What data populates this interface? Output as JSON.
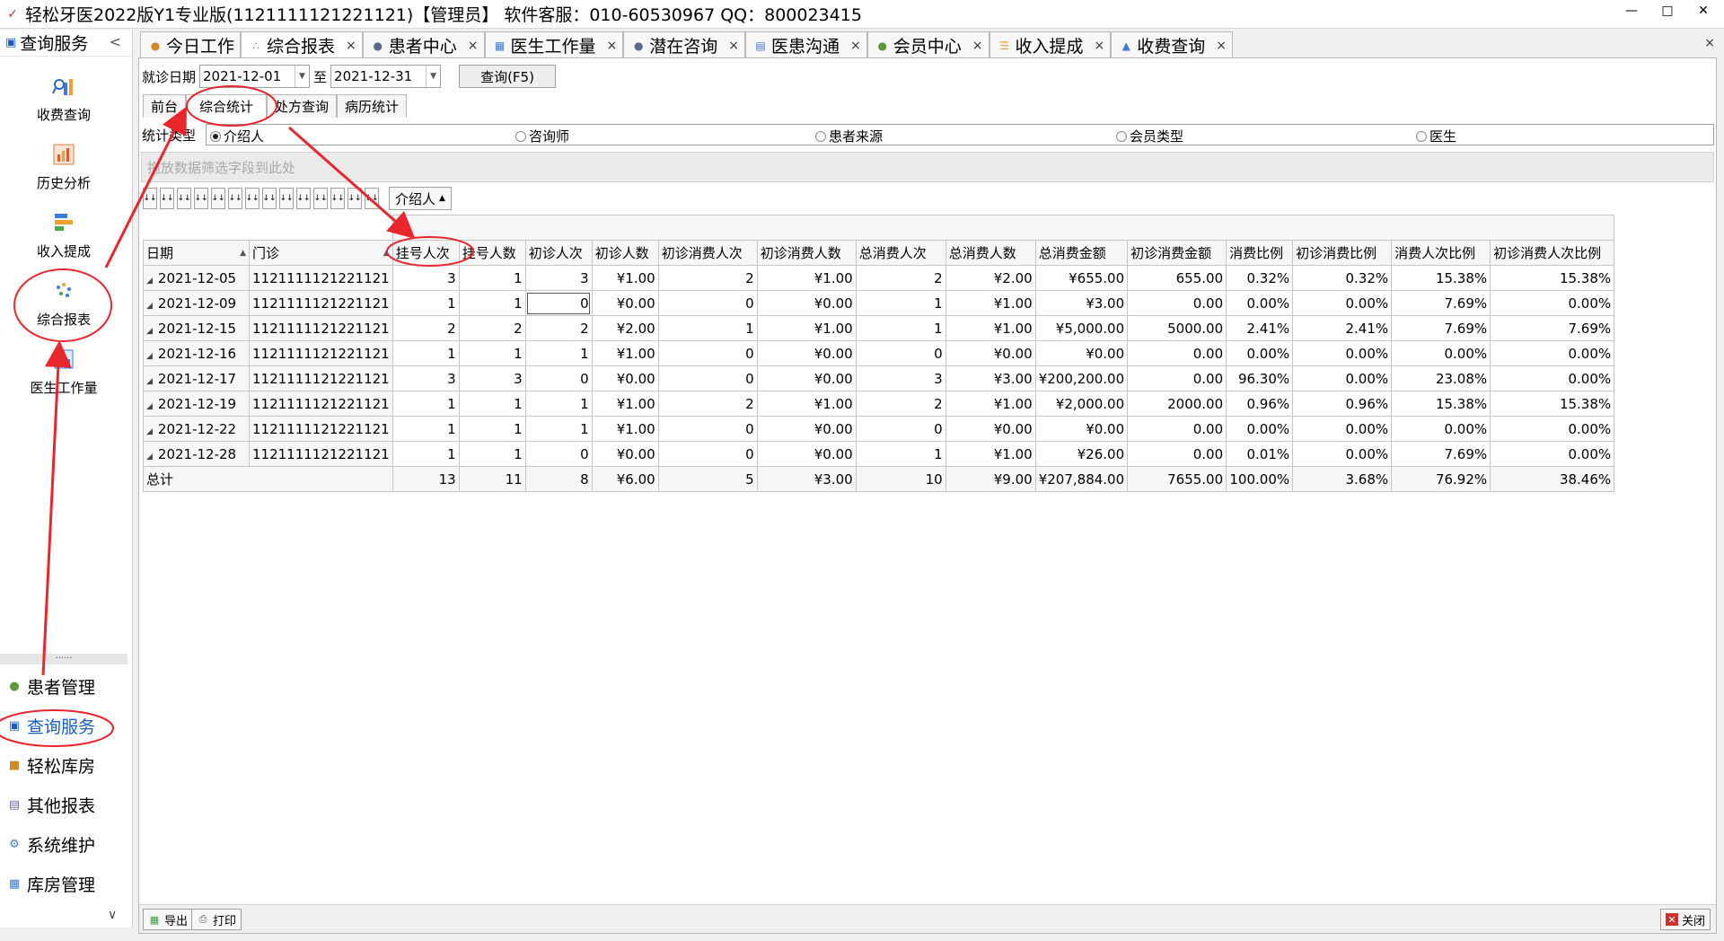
{
  "window": {
    "title": "轻松牙医2022版Y1专业版(1121111121221121)【管理员】    软件客服：010-60530967 QQ：800023415",
    "controls": [
      "—",
      "□",
      "✕"
    ]
  },
  "sidebar": {
    "header": "查询服务",
    "collapse": "<",
    "icon_items": [
      {
        "label": "收费查询",
        "icon": "search-chart-icon"
      },
      {
        "label": "历史分析",
        "icon": "history-chart-icon"
      },
      {
        "label": "收入提成",
        "icon": "income-bars-icon"
      },
      {
        "label": "综合报表",
        "icon": "dots-report-icon"
      },
      {
        "label": "医生工作量",
        "icon": "doctor-workload-icon"
      }
    ],
    "divider": "......",
    "nav_items": [
      {
        "label": "患者管理",
        "icon": "users-icon"
      },
      {
        "label": "查询服务",
        "icon": "query-icon"
      },
      {
        "label": "轻松库房",
        "icon": "box-icon"
      },
      {
        "label": "其他报表",
        "icon": "report-icon"
      },
      {
        "label": "系统维护",
        "icon": "gear-icon"
      },
      {
        "label": "库房管理",
        "icon": "warehouse-icon"
      }
    ],
    "bottom_chevron": "∨"
  },
  "tabs": [
    {
      "label": "今日工作",
      "icon": "person-icon",
      "active": false,
      "closable": false
    },
    {
      "label": "综合报表",
      "icon": "dots-icon",
      "active": true,
      "closable": true
    },
    {
      "label": "患者中心",
      "icon": "patient-icon",
      "active": false,
      "closable": true
    },
    {
      "label": "医生工作量",
      "icon": "doctor-icon",
      "active": false,
      "closable": true
    },
    {
      "label": "潜在咨询",
      "icon": "consult-icon",
      "active": false,
      "closable": true
    },
    {
      "label": "医患沟通",
      "icon": "communication-icon",
      "active": false,
      "closable": true
    },
    {
      "label": "会员中心",
      "icon": "member-icon",
      "active": false,
      "closable": true
    },
    {
      "label": "收入提成",
      "icon": "income-icon",
      "active": false,
      "closable": true
    },
    {
      "label": "收费查询",
      "icon": "charge-icon",
      "active": false,
      "closable": true
    }
  ],
  "close_glyph": "×",
  "filters": {
    "date_label": "就诊日期",
    "date_from": "2021-12-01",
    "to_label": "至",
    "date_to": "2021-12-31",
    "query_button": "查询(F5)"
  },
  "subtabs": [
    {
      "label": "前台",
      "active": false
    },
    {
      "label": "综合统计",
      "active": true
    },
    {
      "label": "处方查询",
      "active": false
    },
    {
      "label": "病历统计",
      "active": false
    }
  ],
  "stat_type": {
    "label": "统计类型",
    "options": [
      {
        "label": "介绍人",
        "selected": true
      },
      {
        "label": "咨询师",
        "selected": false
      },
      {
        "label": "患者来源",
        "selected": false
      },
      {
        "label": "会员类型",
        "selected": false
      },
      {
        "label": "医生",
        "selected": false
      }
    ]
  },
  "filter_area_hint": "拖放数据筛选字段到此处",
  "field_chips": [
    "↓↓",
    "↓↓",
    "↓↓",
    "↓↓",
    "↓↓",
    "↓↓",
    "↓↓",
    "↓↓",
    "↓↓",
    "↓↓",
    "↓↓",
    "↓↓",
    "↓↓",
    "↓↓"
  ],
  "column_field": {
    "label": "介绍人",
    "sort": "▲"
  },
  "grid": {
    "row_headers": [
      {
        "label": "日期",
        "sort": "▲"
      },
      {
        "label": "门诊",
        "sort": "▲"
      }
    ],
    "columns": [
      "挂号人次",
      "挂号人数",
      "初诊人次",
      "初诊人数",
      "初诊消费人次",
      "初诊消费人数",
      "总消费人次",
      "总消费人数",
      "总消费金额",
      "初诊消费金额",
      "消费比例",
      "初诊消费比例",
      "消费人次比例",
      "初诊消费人次比例"
    ],
    "expander": "◢",
    "rows": [
      {
        "date": "2021-12-05",
        "clinic": "1121111121221121",
        "cells": [
          "3",
          "1",
          "3",
          "¥1.00",
          "2",
          "¥1.00",
          "2",
          "¥2.00",
          "¥655.00",
          "655.00",
          "0.32%",
          "0.32%",
          "15.38%",
          "15.38%"
        ]
      },
      {
        "date": "2021-12-09",
        "clinic": "1121111121221121",
        "cells": [
          "1",
          "1",
          "0",
          "¥0.00",
          "0",
          "¥0.00",
          "1",
          "¥1.00",
          "¥3.00",
          "0.00",
          "0.00%",
          "0.00%",
          "7.69%",
          "0.00%"
        ]
      },
      {
        "date": "2021-12-15",
        "clinic": "1121111121221121",
        "cells": [
          "2",
          "2",
          "2",
          "¥2.00",
          "1",
          "¥1.00",
          "1",
          "¥1.00",
          "¥5,000.00",
          "5000.00",
          "2.41%",
          "2.41%",
          "7.69%",
          "7.69%"
        ]
      },
      {
        "date": "2021-12-16",
        "clinic": "1121111121221121",
        "cells": [
          "1",
          "1",
          "1",
          "¥1.00",
          "0",
          "¥0.00",
          "0",
          "¥0.00",
          "¥0.00",
          "0.00",
          "0.00%",
          "0.00%",
          "0.00%",
          "0.00%"
        ]
      },
      {
        "date": "2021-12-17",
        "clinic": "1121111121221121",
        "cells": [
          "3",
          "3",
          "0",
          "¥0.00",
          "0",
          "¥0.00",
          "3",
          "¥3.00",
          "¥200,200.00",
          "0.00",
          "96.30%",
          "0.00%",
          "23.08%",
          "0.00%"
        ]
      },
      {
        "date": "2021-12-19",
        "clinic": "1121111121221121",
        "cells": [
          "1",
          "1",
          "1",
          "¥1.00",
          "2",
          "¥1.00",
          "2",
          "¥1.00",
          "¥2,000.00",
          "2000.00",
          "0.96%",
          "0.96%",
          "15.38%",
          "15.38%"
        ]
      },
      {
        "date": "2021-12-22",
        "clinic": "1121111121221121",
        "cells": [
          "1",
          "1",
          "1",
          "¥1.00",
          "0",
          "¥0.00",
          "0",
          "¥0.00",
          "¥0.00",
          "0.00",
          "0.00%",
          "0.00%",
          "0.00%",
          "0.00%"
        ]
      },
      {
        "date": "2021-12-28",
        "clinic": "1121111121221121",
        "cells": [
          "1",
          "1",
          "0",
          "¥0.00",
          "0",
          "¥0.00",
          "1",
          "¥1.00",
          "¥26.00",
          "0.00",
          "0.01%",
          "0.00%",
          "7.69%",
          "0.00%"
        ]
      }
    ],
    "total": {
      "label": "总计",
      "cells": [
        "13",
        "11",
        "8",
        "¥6.00",
        "5",
        "¥3.00",
        "10",
        "¥9.00",
        "¥207,884.00",
        "7655.00",
        "100.00%",
        "3.68%",
        "76.92%",
        "38.46%"
      ]
    }
  },
  "bottom": {
    "export": "导出",
    "print": "打印",
    "close": "关闭"
  },
  "colors": {
    "annotation": "#e8262b",
    "active_nav": "#1a5cc8"
  }
}
